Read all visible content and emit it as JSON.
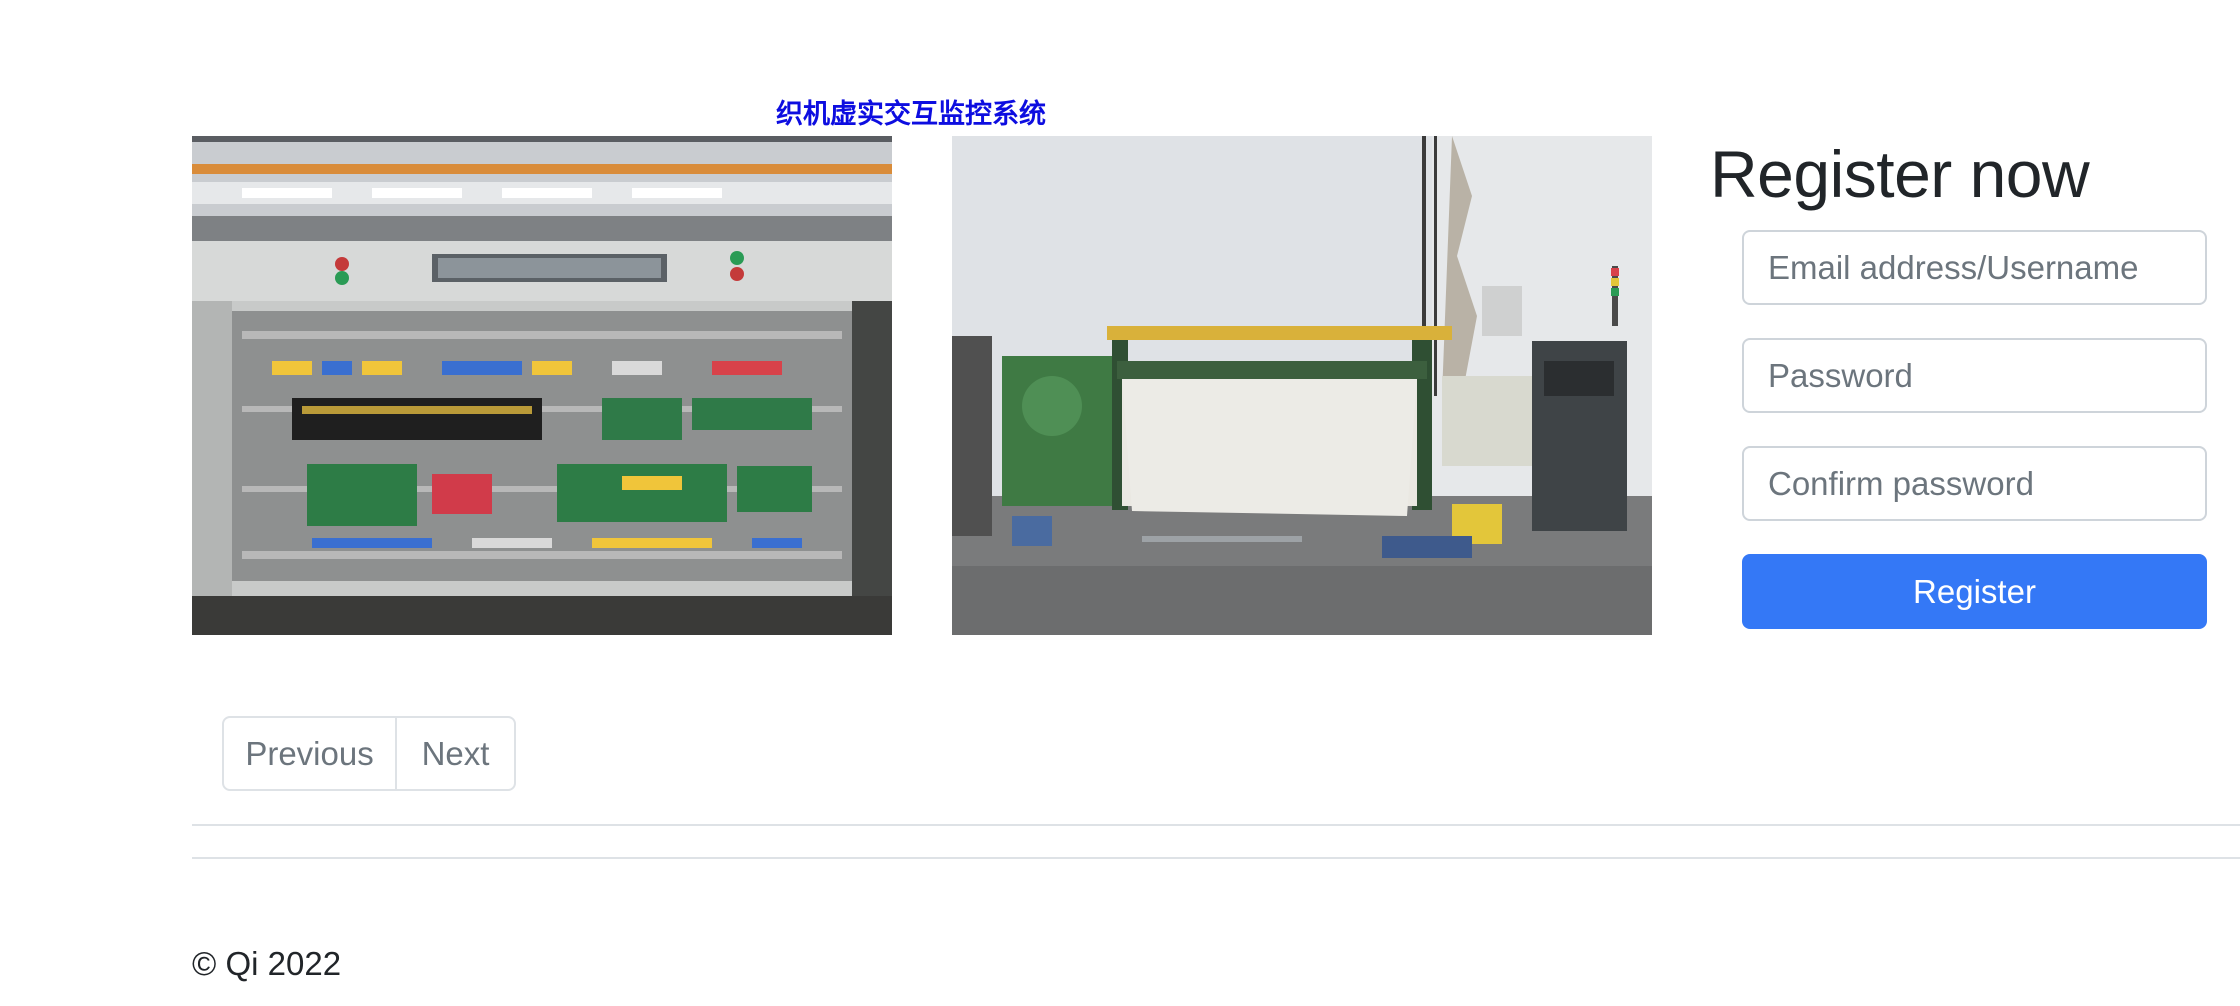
{
  "site": {
    "title": "织机虚实交互监控系统"
  },
  "gallery": {
    "images": [
      {
        "name": "control-cabinet-photo",
        "alt": ""
      },
      {
        "name": "loom-machine-photo",
        "alt": ""
      }
    ],
    "pager": {
      "previous_label": "Previous",
      "next_label": "Next"
    }
  },
  "register": {
    "title": "Register now",
    "email_placeholder": "Email address/Username",
    "password_placeholder": "Password",
    "confirm_placeholder": "Confirm password",
    "submit_label": "Register"
  },
  "footer": {
    "copyright": "© Qi 2022"
  },
  "colors": {
    "title_text": "#0d0de0",
    "primary_button": "#3478f6",
    "border": "#ced4da",
    "muted_text": "#6c757d"
  }
}
